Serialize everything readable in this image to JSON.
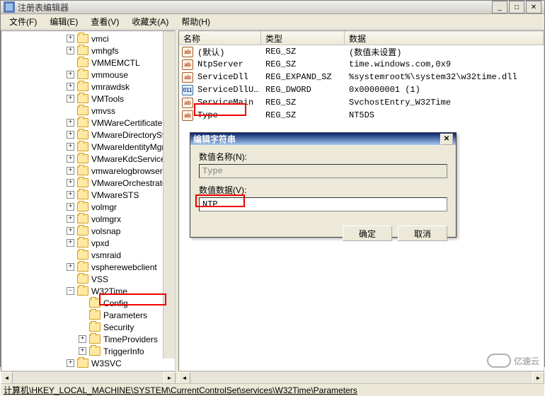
{
  "window": {
    "title": "注册表编辑器"
  },
  "menu": {
    "file": "文件(F)",
    "edit": "编辑(E)",
    "view": "查看(V)",
    "favorites": "收藏夹(A)",
    "help": "帮助(H)"
  },
  "tree": [
    {
      "t": "vmci",
      "d": 0,
      "pm": "+"
    },
    {
      "t": "vmhgfs",
      "d": 0,
      "pm": "+"
    },
    {
      "t": "VMMEMCTL",
      "d": 0,
      "pm": ""
    },
    {
      "t": "vmmouse",
      "d": 0,
      "pm": "+"
    },
    {
      "t": "vmrawdsk",
      "d": 0,
      "pm": "+"
    },
    {
      "t": "VMTools",
      "d": 0,
      "pm": "+"
    },
    {
      "t": "vmvss",
      "d": 0,
      "pm": ""
    },
    {
      "t": "VMWareCertificateSvc",
      "d": 0,
      "pm": "+"
    },
    {
      "t": "VMwareDirectorySvc",
      "d": 0,
      "pm": "+"
    },
    {
      "t": "VMwareIdentityMgmtSvc",
      "d": 0,
      "pm": "+"
    },
    {
      "t": "VMwareKdcService",
      "d": 0,
      "pm": "+"
    },
    {
      "t": "vmwarelogbrowser",
      "d": 0,
      "pm": "+"
    },
    {
      "t": "VMwareOrchestrator",
      "d": 0,
      "pm": "+"
    },
    {
      "t": "VMwareSTS",
      "d": 0,
      "pm": "+"
    },
    {
      "t": "volmgr",
      "d": 0,
      "pm": "+"
    },
    {
      "t": "volmgrx",
      "d": 0,
      "pm": "+"
    },
    {
      "t": "volsnap",
      "d": 0,
      "pm": "+"
    },
    {
      "t": "vpxd",
      "d": 0,
      "pm": "+"
    },
    {
      "t": "vsmraid",
      "d": 0,
      "pm": ""
    },
    {
      "t": "vspherewebclient",
      "d": 0,
      "pm": "+"
    },
    {
      "t": "VSS",
      "d": 0,
      "pm": ""
    },
    {
      "t": "W32Time",
      "d": 0,
      "pm": "-"
    },
    {
      "t": "Config",
      "d": 1,
      "pm": ""
    },
    {
      "t": "Parameters",
      "d": 1,
      "pm": "",
      "hl": true
    },
    {
      "t": "Security",
      "d": 1,
      "pm": ""
    },
    {
      "t": "TimeProviders",
      "d": 1,
      "pm": "+"
    },
    {
      "t": "TriggerInfo",
      "d": 1,
      "pm": "+"
    },
    {
      "t": "W3SVC",
      "d": 0,
      "pm": "+"
    }
  ],
  "columns": {
    "name": "名称",
    "type": "类型",
    "data": "数据"
  },
  "values": [
    {
      "name": "(默认)",
      "type": "REG_SZ",
      "data": "(数值未设置)",
      "icon": "str"
    },
    {
      "name": "NtpServer",
      "type": "REG_SZ",
      "data": "time.windows.com,0x9",
      "icon": "str"
    },
    {
      "name": "ServiceDll",
      "type": "REG_EXPAND_SZ",
      "data": "%systemroot%\\system32\\w32time.dll",
      "icon": "str"
    },
    {
      "name": "ServiceDllUnl…",
      "type": "REG_DWORD",
      "data": "0x00000001 (1)",
      "icon": "bin"
    },
    {
      "name": "ServiceMain",
      "type": "REG_SZ",
      "data": "SvchostEntry_W32Time",
      "icon": "str"
    },
    {
      "name": "Type",
      "type": "REG_SZ",
      "data": "NT5DS",
      "icon": "str",
      "hl": true
    }
  ],
  "dialog": {
    "title": "编辑字符串",
    "name_label": "数值名称(N):",
    "name_value": "Type",
    "data_label": "数值数据(V):",
    "data_value": "NTP",
    "ok": "确定",
    "cancel": "取消"
  },
  "status": "计算机\\HKEY_LOCAL_MACHINE\\SYSTEM\\CurrentControlSet\\services\\W32Time\\Parameters",
  "watermark": "亿速云"
}
